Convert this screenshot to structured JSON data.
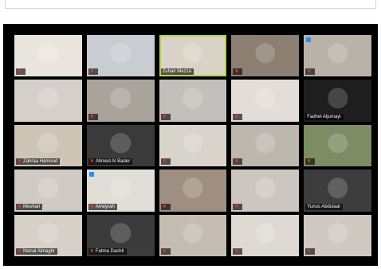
{
  "accent": "#b7d63a",
  "muted_color": "#e0362f",
  "tiles": [
    {
      "name": "",
      "bg": "#e9e4de",
      "muted": true,
      "pinned": false,
      "active": false
    },
    {
      "name": "",
      "bg": "#c9cdd3",
      "muted": true,
      "pinned": false,
      "active": false
    },
    {
      "name": "Zuhair Mezza",
      "bg": "#d9d2c6",
      "muted": false,
      "pinned": false,
      "active": true
    },
    {
      "name": "",
      "bg": "#8d7f71",
      "muted": true,
      "pinned": false,
      "active": false
    },
    {
      "name": "",
      "bg": "#b9b2a8",
      "muted": true,
      "pinned": true,
      "active": false
    },
    {
      "name": "",
      "bg": "#d4cfc8",
      "muted": false,
      "pinned": false,
      "active": false
    },
    {
      "name": "",
      "bg": "#a9a39c",
      "muted": true,
      "pinned": false,
      "active": false
    },
    {
      "name": "",
      "bg": "#c3c0bb",
      "muted": true,
      "pinned": false,
      "active": false
    },
    {
      "name": "",
      "bg": "#e2ddd6",
      "muted": true,
      "pinned": false,
      "active": false
    },
    {
      "name": "Fadhel Aljumayi",
      "bg": "#1e1e1e",
      "muted": false,
      "pinned": false,
      "active": false
    },
    {
      "name": "Zahraa Hamoud",
      "bg": "#cfc5b7",
      "muted": true,
      "pinned": false,
      "active": false
    },
    {
      "name": "Ahmed Al Bader",
      "bg": "#3a3a3a",
      "muted": true,
      "pinned": false,
      "active": false
    },
    {
      "name": "",
      "bg": "#d8d3cb",
      "muted": true,
      "pinned": false,
      "active": false
    },
    {
      "name": "",
      "bg": "#bdb7ae",
      "muted": true,
      "pinned": false,
      "active": false
    },
    {
      "name": "",
      "bg": "#7d8c63",
      "muted": true,
      "pinned": false,
      "active": false
    },
    {
      "name": "Meshari",
      "bg": "#cfcac4",
      "muted": true,
      "pinned": false,
      "active": false
    },
    {
      "name": "Ameyrah",
      "bg": "#e1ddd7",
      "muted": true,
      "pinned": true,
      "active": false
    },
    {
      "name": "",
      "bg": "#9f8f82",
      "muted": true,
      "pinned": false,
      "active": false
    },
    {
      "name": "",
      "bg": "#cbc6bf",
      "muted": true,
      "pinned": false,
      "active": false
    },
    {
      "name": "Yunus Abdulaal",
      "bg": "#3d3d3d",
      "muted": false,
      "pinned": false,
      "active": false
    },
    {
      "name": "Manal Almaghr",
      "bg": "#d6d0c8",
      "muted": true,
      "pinned": false,
      "active": false
    },
    {
      "name": "Fatma Dashti",
      "bg": "#3b3b3b",
      "muted": true,
      "pinned": false,
      "active": false
    },
    {
      "name": "",
      "bg": "#c4bcb1",
      "muted": true,
      "pinned": false,
      "active": false
    },
    {
      "name": "",
      "bg": "#dedad3",
      "muted": true,
      "pinned": false,
      "active": false
    },
    {
      "name": "",
      "bg": "#cfc9c1",
      "muted": true,
      "pinned": false,
      "active": false
    }
  ]
}
